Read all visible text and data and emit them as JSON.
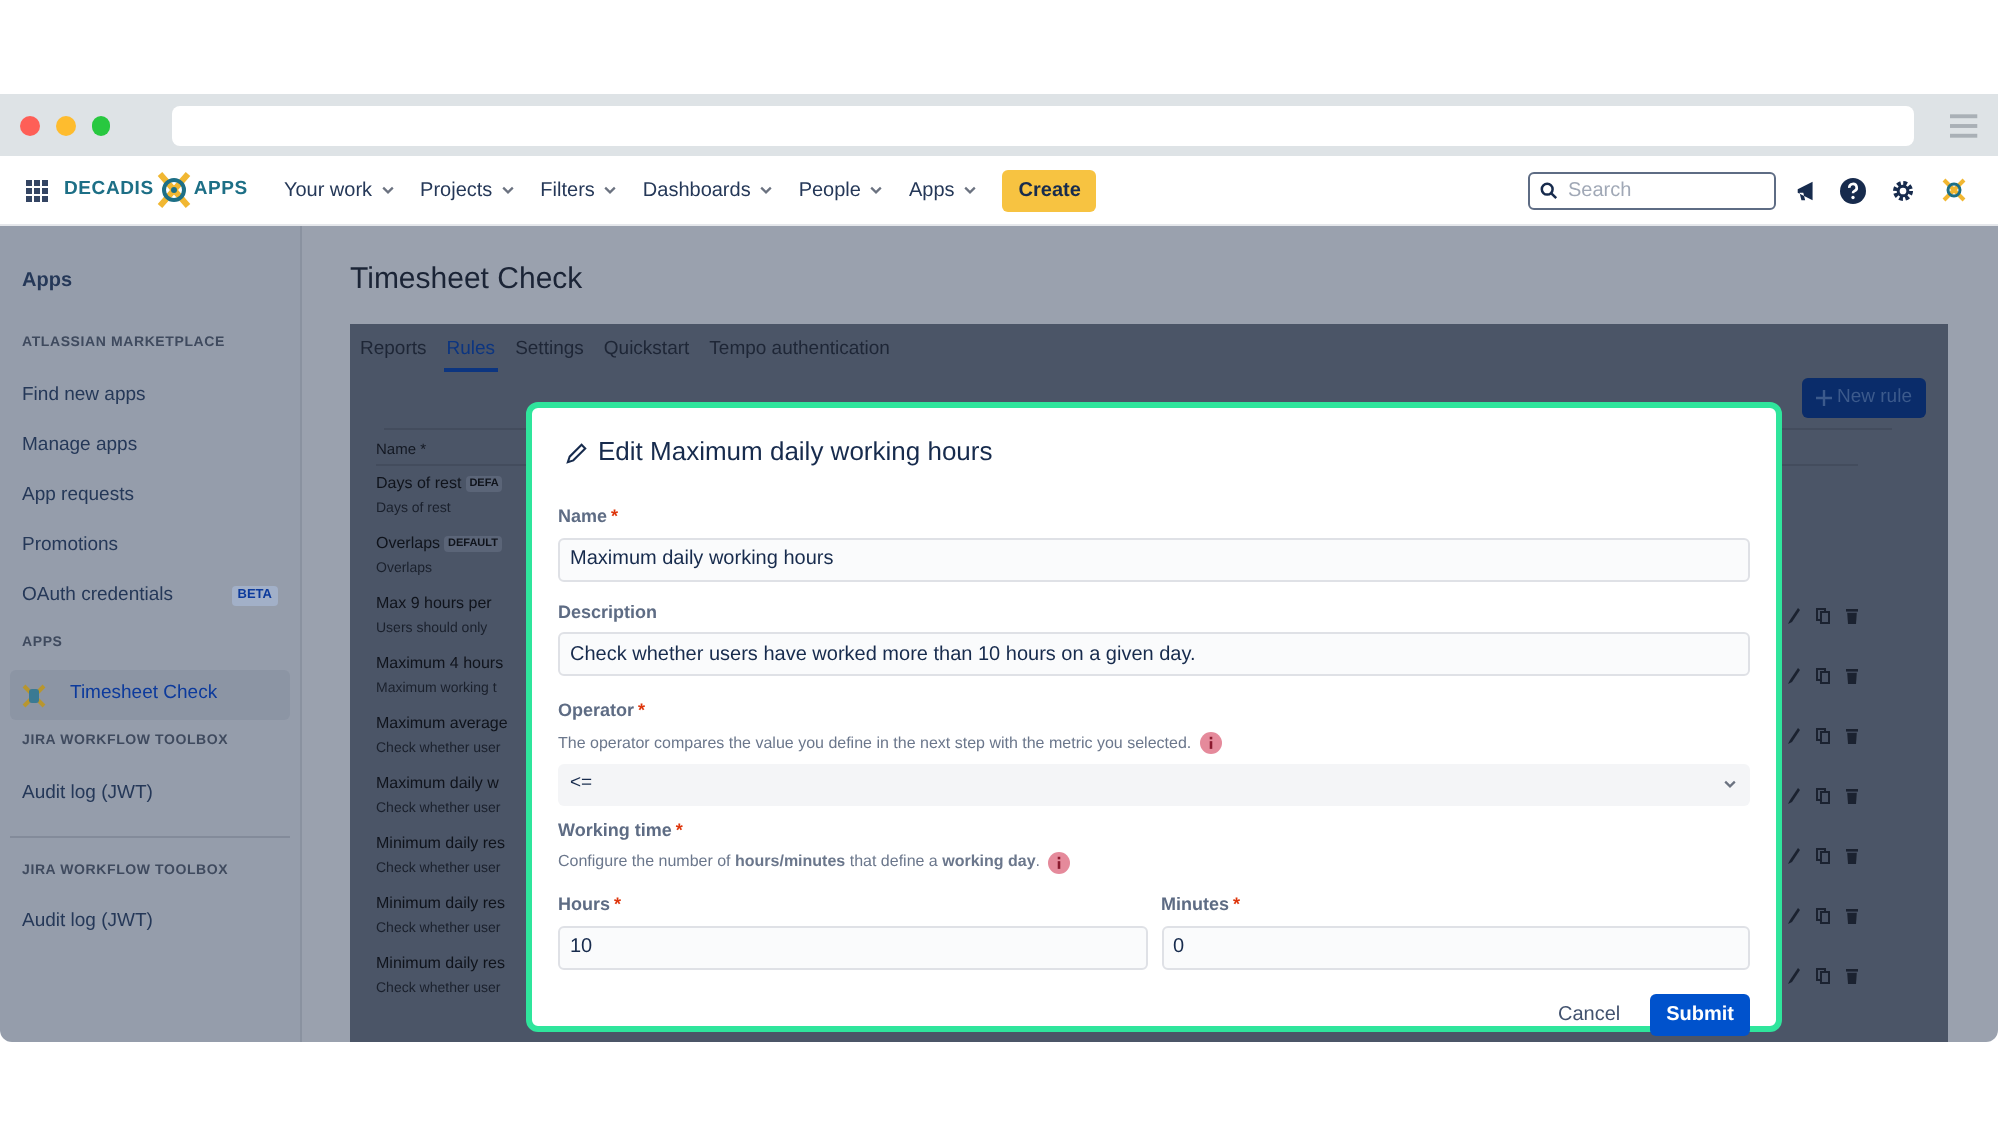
{
  "nav": {
    "logo": {
      "left": "DECADIS",
      "right": "APPS"
    },
    "menus": [
      {
        "label": "Your work"
      },
      {
        "label": "Projects"
      },
      {
        "label": "Filters"
      },
      {
        "label": "Dashboards"
      },
      {
        "label": "People"
      },
      {
        "label": "Apps"
      }
    ],
    "create": "Create",
    "search": {
      "placeholder": "Search"
    }
  },
  "sidebar": {
    "title": "Apps",
    "sections": [
      {
        "heading": "ATLASSIAN MARKETPLACE",
        "divider": false,
        "items": [
          {
            "label": "Find new apps",
            "selected": false
          },
          {
            "label": "Manage apps",
            "selected": false
          },
          {
            "label": "App requests",
            "selected": false
          },
          {
            "label": "Promotions",
            "selected": false
          },
          {
            "label": "OAuth credentials",
            "selected": false,
            "badge": "BETA"
          }
        ]
      },
      {
        "heading": "APPS",
        "divider": false,
        "items": [
          {
            "label": "Timesheet Check",
            "selected": true,
            "icon": true
          }
        ]
      },
      {
        "heading": "JIRA WORKFLOW TOOLBOX",
        "divider": false,
        "items": [
          {
            "label": "Audit log (JWT)",
            "selected": false
          }
        ]
      },
      {
        "heading": "JIRA WORKFLOW TOOLBOX",
        "divider": true,
        "items": [
          {
            "label": "Audit log (JWT)",
            "selected": false
          }
        ]
      }
    ]
  },
  "page": {
    "title": "Timesheet Check",
    "tabs": [
      {
        "label": "Reports",
        "selected": false
      },
      {
        "label": "Rules",
        "selected": true
      },
      {
        "label": "Settings",
        "selected": false
      },
      {
        "label": "Quickstart",
        "selected": false
      },
      {
        "label": "Tempo authentication",
        "selected": false
      }
    ],
    "new_rule": "New rule",
    "table": {
      "header": "Name *",
      "rows": [
        {
          "name": "Days of rest",
          "badge": "DEFA",
          "sub": "Days of rest",
          "actions": false
        },
        {
          "name": "Overlaps",
          "badge": "DEFAULT",
          "sub": "Overlaps",
          "actions": false
        },
        {
          "name": "Max 9 hours per",
          "sub": "Users should only",
          "actions": true
        },
        {
          "name": "Maximum 4 hours",
          "sub": "Maximum working t",
          "actions": true
        },
        {
          "name": "Maximum average",
          "sub": "Check whether user",
          "actions": true
        },
        {
          "name": "Maximum daily w",
          "sub": "Check whether user",
          "actions": true
        },
        {
          "name": "Minimum daily res",
          "sub": "Check whether user",
          "actions": true
        },
        {
          "name": "Minimum daily res",
          "sub": "Check whether user",
          "actions": true
        },
        {
          "name": "Minimum daily res",
          "sub": "Check whether user",
          "actions": true
        }
      ]
    }
  },
  "modal": {
    "title": "Edit Maximum daily working hours",
    "required_mark": "*",
    "name": {
      "label": "Name",
      "required": true,
      "value": "Maximum daily working hours"
    },
    "description": {
      "label": "Description",
      "required": false,
      "value": "Check whether users have worked more than 10 hours on a given day."
    },
    "operator": {
      "label": "Operator",
      "required": true,
      "help": "The operator compares the value you define in the next step with the metric you selected.",
      "value": "<="
    },
    "working_time": {
      "label": "Working time",
      "required": true,
      "help": "Configure the number of **hours/minutes** that define a **working day**."
    },
    "hours": {
      "label": "Hours",
      "required": true,
      "value": "10"
    },
    "minutes": {
      "label": "Minutes",
      "required": true,
      "value": "0"
    },
    "cancel": "Cancel",
    "submit": "Submit"
  }
}
